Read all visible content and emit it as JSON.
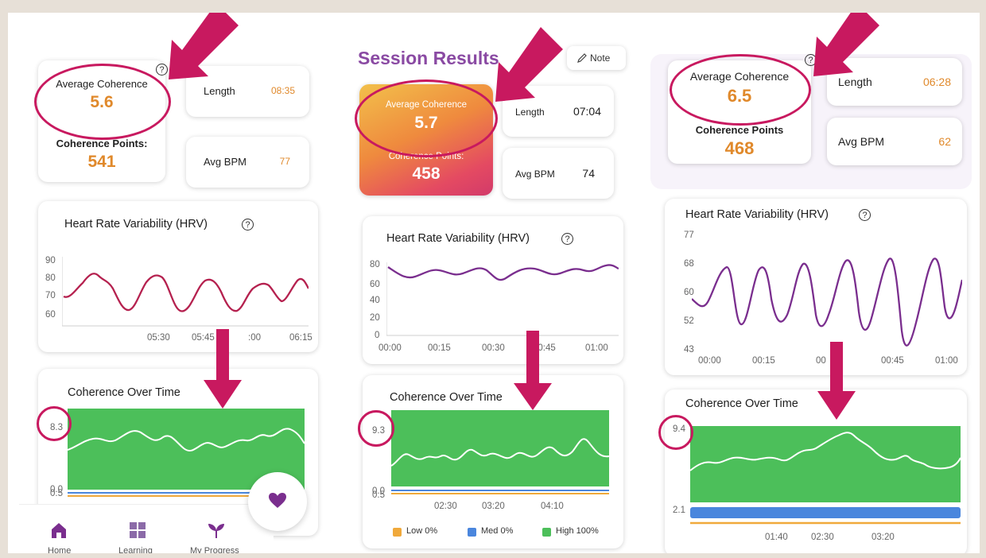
{
  "panel1": {
    "stats": {
      "avg_coherence_label": "Average Coherence",
      "avg_coherence_value": "5.6",
      "points_label": "Coherence Points:",
      "points_value": "541",
      "length_label": "Length",
      "length_value": "08:35",
      "bpm_label": "Avg BPM",
      "bpm_value": "77",
      "help": "?"
    },
    "hrv": {
      "title": "Heart Rate Variability (HRV)",
      "help": "?",
      "y_ticks": [
        "90",
        "80",
        "70",
        "60"
      ],
      "x_ticks": [
        "05:30",
        "05:45",
        ":00",
        "06:15"
      ]
    },
    "coherence": {
      "title": "Coherence Over Time",
      "y_top": "8.3",
      "y_bottom": "0.0",
      "y_bottom2": "0.5"
    },
    "nav": {
      "items": [
        {
          "label": "Home",
          "icon": "home-icon"
        },
        {
          "label": "Learning",
          "icon": "grid-icon"
        },
        {
          "label": "My Progress",
          "icon": "sprout-icon"
        }
      ],
      "fab_icon": "heart-icon"
    }
  },
  "panel2": {
    "header": {
      "title": "Session Results",
      "note_label": "Note",
      "note_icon": "pencil-icon"
    },
    "stats": {
      "avg_coherence_label": "Average Coherence",
      "avg_coherence_value": "5.7",
      "points_label": "Coherence Points:",
      "points_value": "458",
      "length_label": "Length",
      "length_value": "07:04",
      "bpm_label": "Avg BPM",
      "bpm_value": "74"
    },
    "hrv": {
      "title": "Heart Rate Variability (HRV)",
      "help": "?",
      "y_ticks": [
        "80",
        "60",
        "40",
        "20",
        "0"
      ],
      "x_ticks": [
        "00:00",
        "00:15",
        "00:30",
        "00:45",
        "01:00"
      ]
    },
    "coherence": {
      "title": "Coherence Over Time",
      "y_top": "9.3",
      "y_bottom": "0.0",
      "y_bottom2": "0.5",
      "x_ticks": [
        "02:30",
        "03:20",
        "04:10"
      ],
      "legend": [
        {
          "label": "Low 0%",
          "color": "#f0a93b"
        },
        {
          "label": "Med 0%",
          "color": "#4a86dd"
        },
        {
          "label": "High 100%",
          "color": "#4cbf5a"
        }
      ]
    }
  },
  "panel3": {
    "stats": {
      "avg_coherence_label": "Average Coherence",
      "avg_coherence_value": "6.5",
      "points_label": "Coherence Points",
      "points_value": "468",
      "length_label": "Length",
      "length_value": "06:28",
      "bpm_label": "Avg BPM",
      "bpm_value": "62",
      "help": "?"
    },
    "hrv": {
      "title": "Heart Rate Variability (HRV)",
      "help": "?",
      "y_ticks": [
        "77",
        "68",
        "60",
        "52",
        "43"
      ],
      "x_ticks": [
        "00:00",
        "00:15",
        "00",
        "00:45",
        "01:00"
      ]
    },
    "coherence": {
      "title": "Coherence Over Time",
      "y_top": "9.4",
      "y_bottom": "2.1",
      "x_ticks": [
        "01:40",
        "02:30",
        "03:20"
      ]
    }
  },
  "colors": {
    "accent_pink": "#c8195f",
    "orange": "#e0892b",
    "green": "#4cbf5a",
    "blue": "#4a86dd",
    "purple": "#7a2e8e",
    "crimson": "#b5214f"
  }
}
